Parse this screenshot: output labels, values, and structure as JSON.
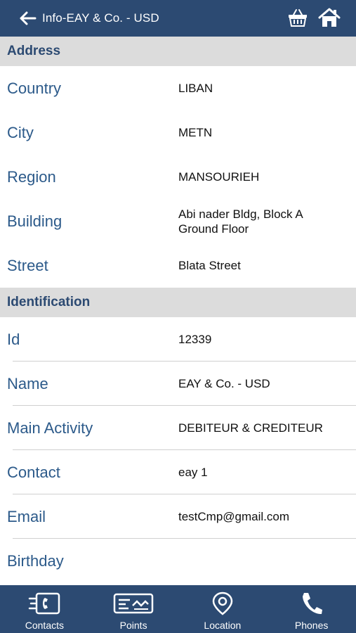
{
  "header": {
    "title": "Info-EAY & Co. - USD",
    "back_icon": "arrow-left-icon",
    "basket_icon": "basket-icon",
    "home_icon": "home-icon"
  },
  "address": {
    "heading": "Address",
    "rows": [
      {
        "label": "Country",
        "value": "LIBAN"
      },
      {
        "label": "City",
        "value": "METN"
      },
      {
        "label": "Region",
        "value": "MANSOURIEH"
      },
      {
        "label": "Building",
        "value_line1": "Abi nader Bldg, Block A",
        "value_line2": "Ground Floor"
      },
      {
        "label": "Street",
        "value": "Blata Street"
      }
    ]
  },
  "identification": {
    "heading": "Identification",
    "rows": [
      {
        "label": "Id",
        "value": "12339"
      },
      {
        "label": "Name",
        "value": "EAY & Co. - USD"
      },
      {
        "label": "Main Activity",
        "value": "DEBITEUR & CREDITEUR"
      },
      {
        "label": "Contact",
        "value": "eay 1"
      },
      {
        "label": "Email",
        "value": "testCmp@gmail.com"
      },
      {
        "label": "Birthday",
        "value": ""
      }
    ]
  },
  "tabs": [
    {
      "label": "Contacts",
      "icon": "contacts-icon"
    },
    {
      "label": "Points",
      "icon": "points-card-icon"
    },
    {
      "label": "Location",
      "icon": "location-pin-icon"
    },
    {
      "label": "Phones",
      "icon": "phone-icon"
    }
  ],
  "colors": {
    "primary": "#2c4a72",
    "label": "#2c5a8a",
    "section_bg": "#dcdcdc"
  }
}
